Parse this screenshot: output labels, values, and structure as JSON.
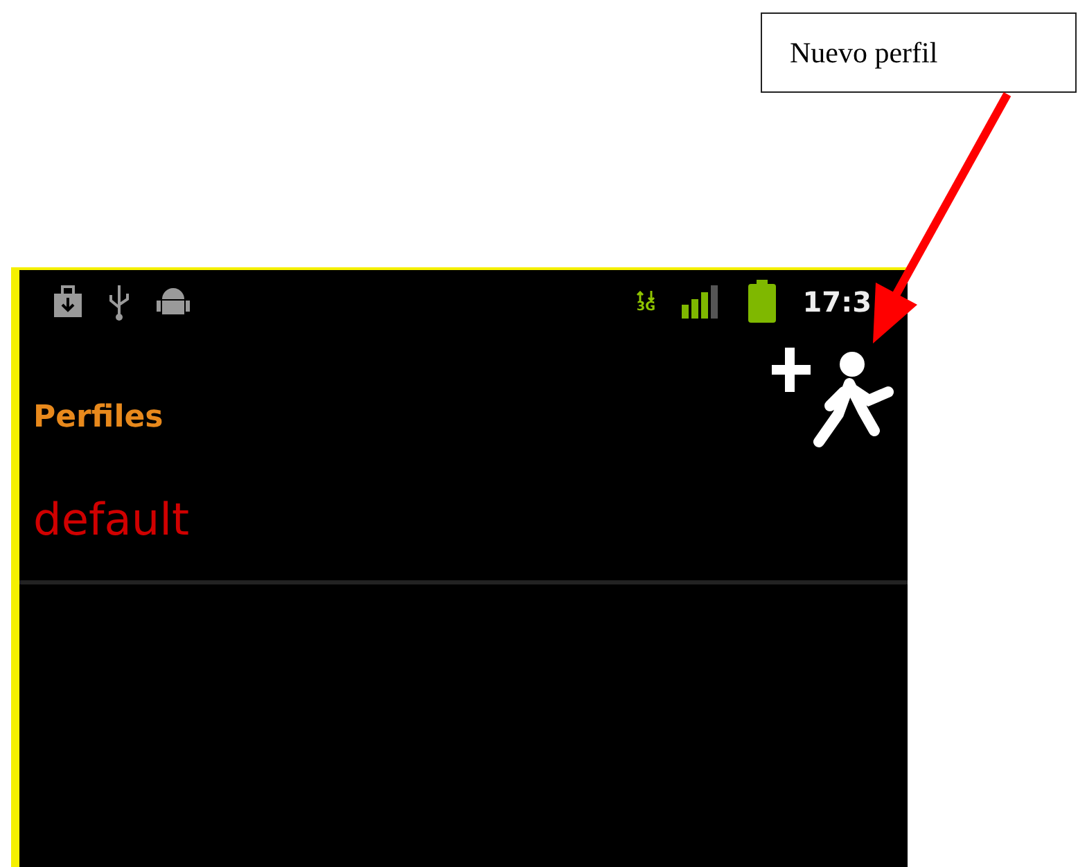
{
  "callout": {
    "text": "Nuevo perfil"
  },
  "status_bar": {
    "network": "3G",
    "time": "17:3"
  },
  "app_bar": {
    "title": "Perfiles"
  },
  "profiles": [
    {
      "name": "default"
    }
  ]
}
